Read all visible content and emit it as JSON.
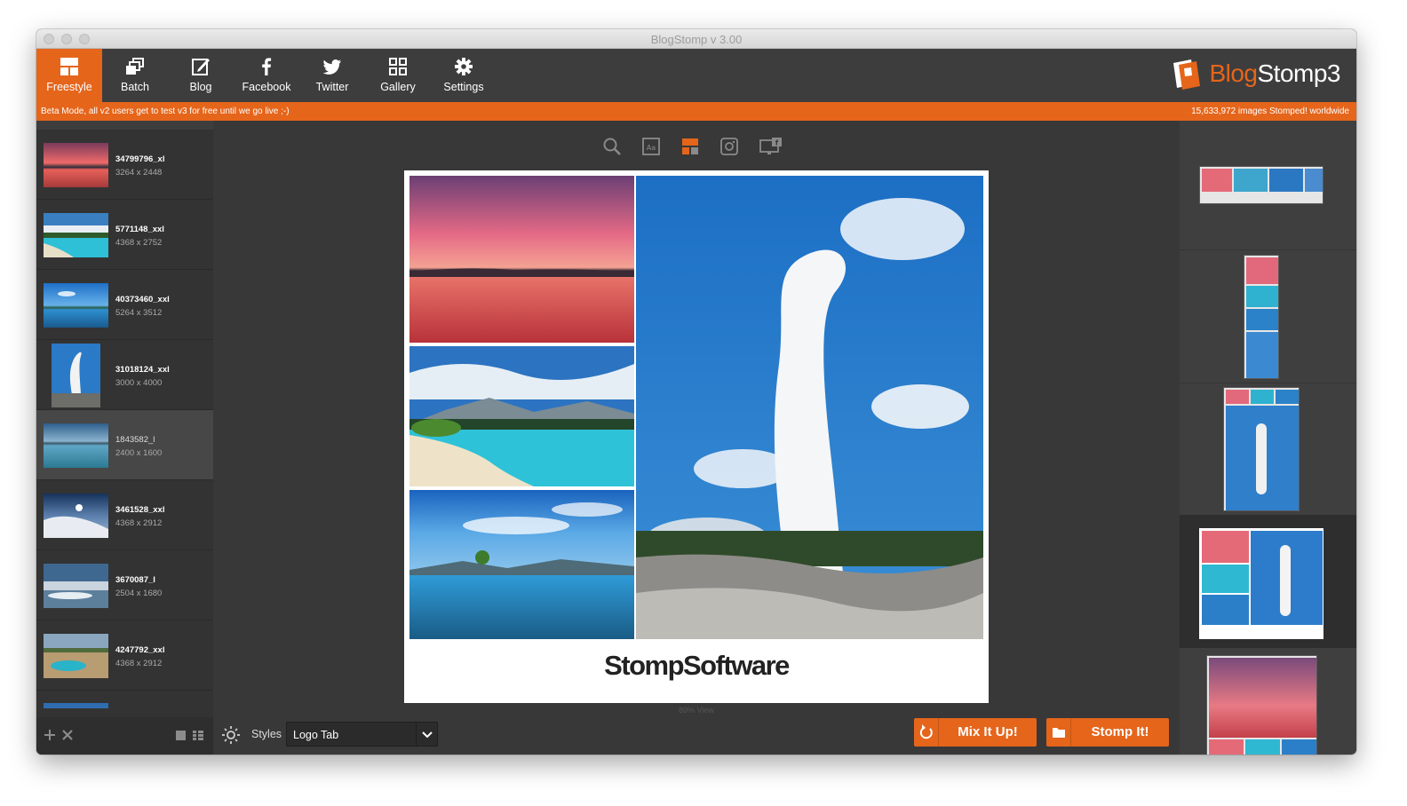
{
  "window": {
    "title": "BlogStomp v 3.00"
  },
  "toolbar": {
    "items": [
      {
        "label": "Freestyle",
        "icon": "freestyle-layout-icon",
        "active": true
      },
      {
        "label": "Batch",
        "icon": "batch-stack-icon",
        "active": false
      },
      {
        "label": "Blog",
        "icon": "blog-edit-icon",
        "active": false
      },
      {
        "label": "Facebook",
        "icon": "facebook-icon",
        "active": false
      },
      {
        "label": "Twitter",
        "icon": "twitter-bird-icon",
        "active": false
      },
      {
        "label": "Gallery",
        "icon": "gallery-grid-icon",
        "active": false
      },
      {
        "label": "Settings",
        "icon": "gear-icon",
        "active": false
      }
    ],
    "logo": {
      "part1": "Blog",
      "part2": "Stomp3"
    }
  },
  "beta": {
    "left": "Beta Mode, all v2 users get to test v3 for free until we go live ;-)",
    "right": "15,633,972 images Stomped! worldwide"
  },
  "sidebar": {
    "items": [
      {
        "name": "34799796_xl",
        "dims": "3264 x 2448",
        "thumb": "sunset"
      },
      {
        "name": "5771148_xxl",
        "dims": "4368 x 2752",
        "thumb": "lake"
      },
      {
        "name": "40373460_xxl",
        "dims": "5264 x 3512",
        "thumb": "blue-lake"
      },
      {
        "name": "31018124_xxl",
        "dims": "3000 x 4000",
        "thumb": "geyser"
      },
      {
        "name": "1843582_l",
        "dims": "2400 x 1600",
        "thumb": "calm-sea"
      },
      {
        "name": "3461528_xxl",
        "dims": "4368 x 2912",
        "thumb": "snow"
      },
      {
        "name": "3670087_l",
        "dims": "2504 x 1680",
        "thumb": "clouds"
      },
      {
        "name": "4247792_xxl",
        "dims": "4368 x 2912",
        "thumb": "hot-spring"
      }
    ],
    "selected_index": 4
  },
  "canvas": {
    "tools": [
      "search-icon",
      "text-icon",
      "layout-icon",
      "instagram-icon",
      "facebook-cover-icon"
    ],
    "brand_text": "StompSoftware",
    "view_label": "89% View"
  },
  "bottom": {
    "styles_label": "Styles",
    "styles_value": "Logo Tab",
    "mix_label": "Mix It Up!",
    "stomp_label": "Stomp It!"
  },
  "colors": {
    "accent": "#e5651b",
    "toolbar": "#3d3d3d",
    "panel": "#333333"
  }
}
